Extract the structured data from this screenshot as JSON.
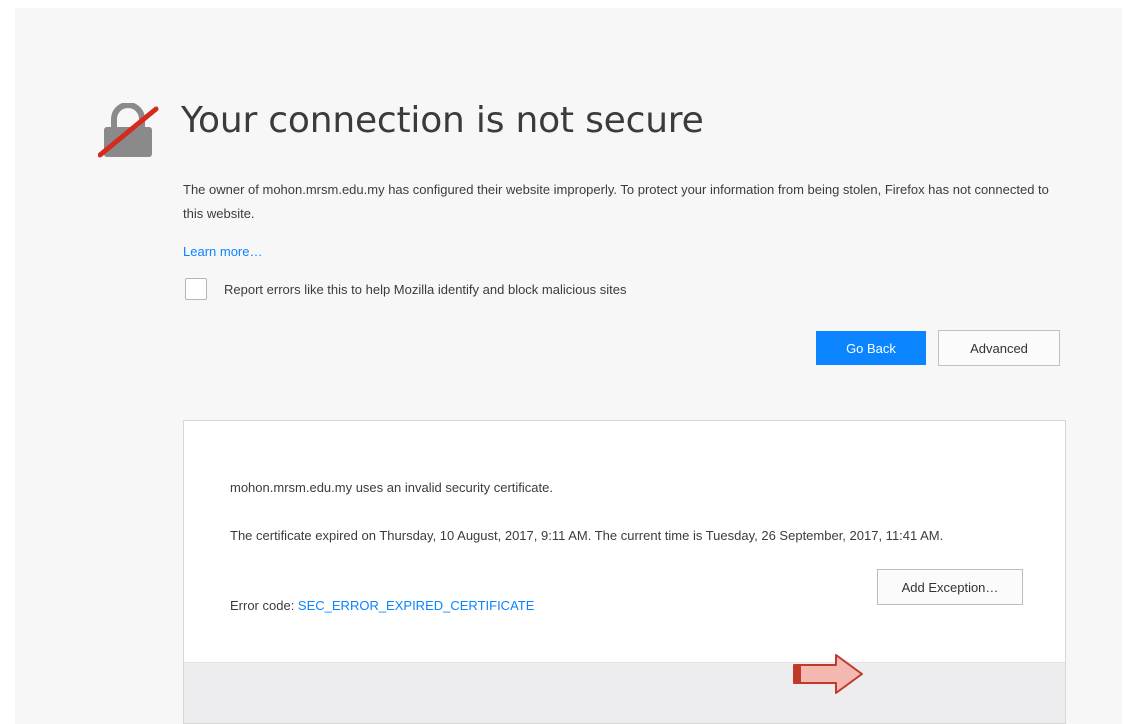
{
  "page": {
    "title": "Your connection is not secure",
    "description": "The owner of mohon.mrsm.edu.my has configured their website improperly. To protect your information from being stolen, Firefox has not connected to this website.",
    "learn_more": "Learn more…",
    "report_label": "Report errors like this to help Mozilla identify and block malicious sites",
    "report_checked": false
  },
  "buttons": {
    "go_back": "Go Back",
    "advanced": "Advanced",
    "add_exception": "Add Exception…"
  },
  "advanced_panel": {
    "line1": "mohon.mrsm.edu.my uses an invalid security certificate.",
    "line2": "The certificate expired on Thursday, 10 August, 2017, 9:11 AM. The current time is Tuesday, 26 September, 2017, 11:41 AM.",
    "error_label": "Error code: ",
    "error_code": "SEC_ERROR_EXPIRED_CERTIFICATE"
  },
  "icons": {
    "lock": "broken-lock-icon",
    "arrow": "red-arrow-icon"
  },
  "colors": {
    "accent": "#0a84ff",
    "arrow_fill": "#f4b8b0",
    "arrow_stroke": "#c0392b",
    "lock_slash": "#d52b1e"
  }
}
